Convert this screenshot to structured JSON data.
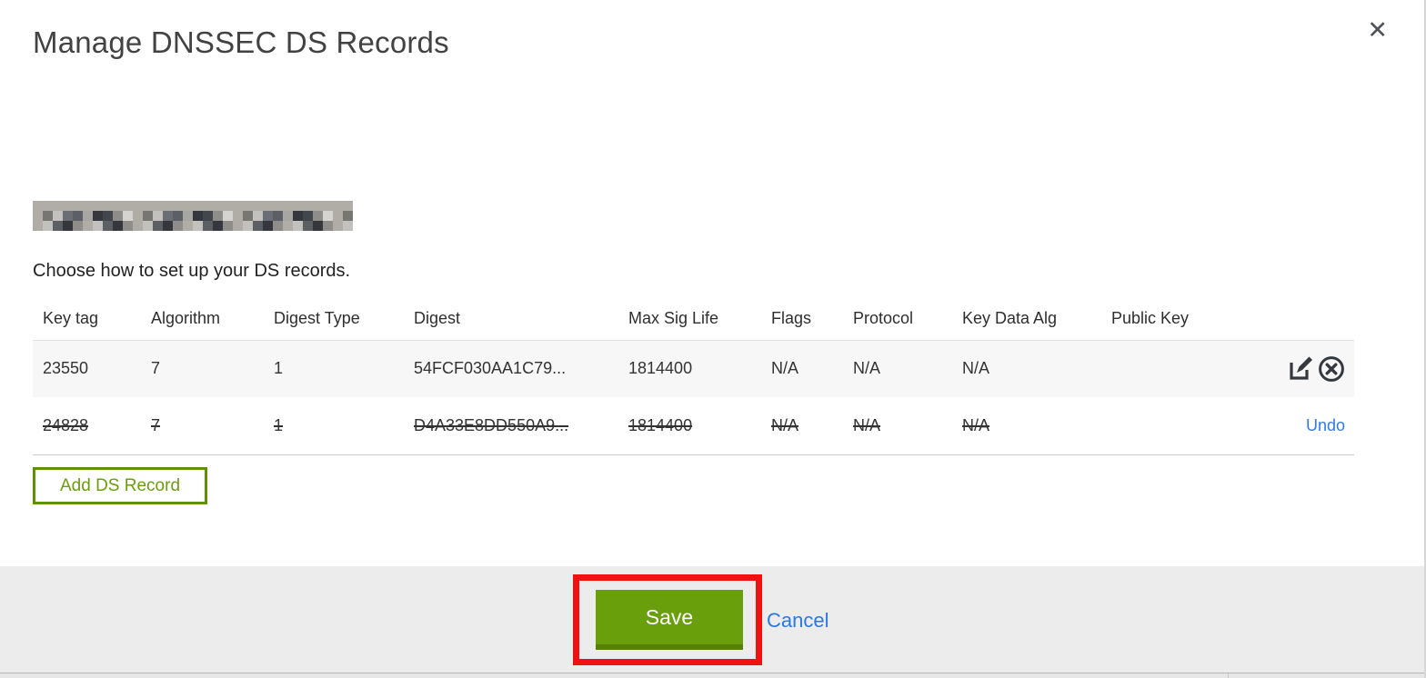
{
  "modal": {
    "title": "Manage DNSSEC DS Records",
    "close_label": "✕",
    "instruction": "Choose how to set up your DS records.",
    "add_button_label": "Add DS Record",
    "save_label": "Save",
    "cancel_label": "Cancel"
  },
  "table": {
    "columns": [
      "Key tag",
      "Algorithm",
      "Digest Type",
      "Digest",
      "Max Sig Life",
      "Flags",
      "Protocol",
      "Key Data Alg",
      "Public Key"
    ],
    "rows": [
      {
        "key_tag": "23550",
        "algorithm": "7",
        "digest_type": "1",
        "digest": "54FCF030AA1C79...",
        "max_sig_life": "1814400",
        "flags": "N/A",
        "protocol": "N/A",
        "key_data_alg": "N/A",
        "public_key": "",
        "state": "active",
        "actions": [
          "edit",
          "delete"
        ]
      },
      {
        "key_tag": "24828",
        "algorithm": "7",
        "digest_type": "1",
        "digest": "D4A33E8DD550A9...",
        "max_sig_life": "1814400",
        "flags": "N/A",
        "protocol": "N/A",
        "key_data_alg": "N/A",
        "public_key": "",
        "state": "deleted",
        "action_label": "Undo"
      }
    ]
  },
  "colors": {
    "accent_green": "#699f0b",
    "accent_green_dark": "#567f0a",
    "link_blue": "#2f7de1",
    "annotation_red": "#ee1310",
    "footer_gray": "#ececec",
    "row_gray": "#f7f7f7"
  }
}
